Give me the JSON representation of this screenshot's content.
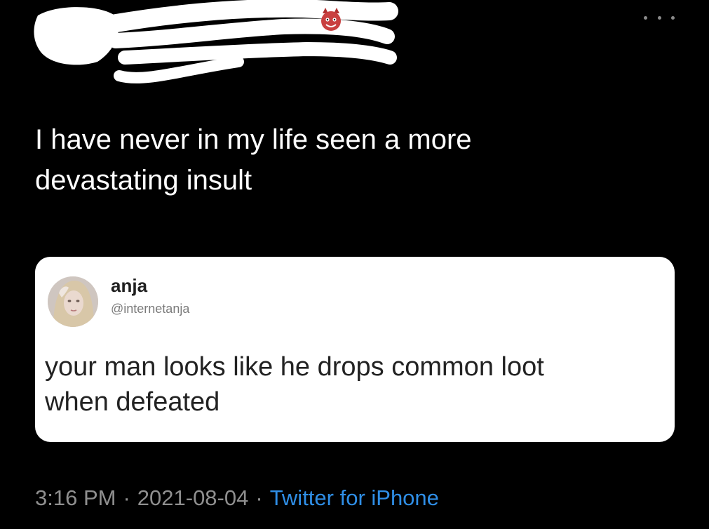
{
  "author": {
    "name": "",
    "handle": "",
    "redacted": true
  },
  "tweet": {
    "text_line_1": "I have never in my life seen a more",
    "text_line_2": "devastating insult"
  },
  "quoted_tweet": {
    "name": "anja",
    "handle": "@internetanja",
    "text_line_1": "your man looks like he drops common loot",
    "text_line_2": "when defeated"
  },
  "meta": {
    "time": "3:16 PM",
    "separator": "·",
    "date": "2021-08-04",
    "source": "Twitter for iPhone"
  },
  "icons": {
    "more": "more-options-icon",
    "emoji": "devil-face-emoji-icon"
  },
  "colors": {
    "background": "#000000",
    "text": "#ffffff",
    "muted": "#8f8f8f",
    "link": "#2f8ee6",
    "card": "#ffffff",
    "redaction": "#ffffff"
  }
}
